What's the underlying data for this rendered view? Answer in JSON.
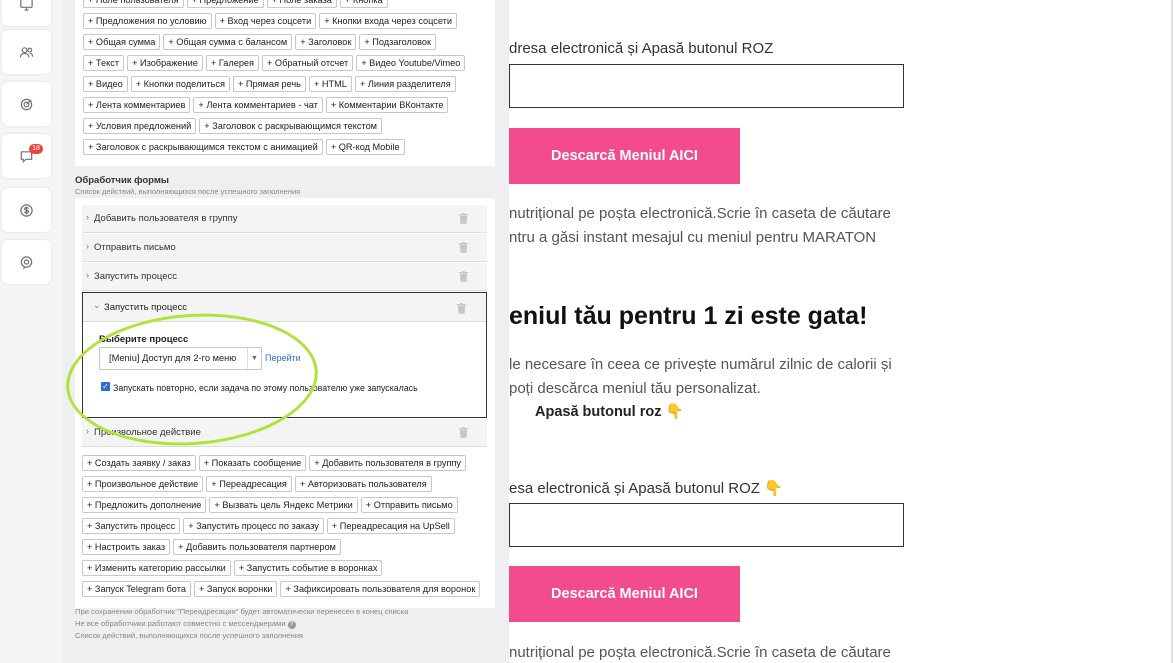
{
  "rail": {
    "badge": "18",
    "icons": [
      "monitor-icon",
      "users-icon",
      "target-icon",
      "chat-icon",
      "dollar-icon",
      "support-icon"
    ]
  },
  "editor": {
    "chips_top": [
      "+ Поле пользователя",
      "+ Предложение",
      "+ Поле заказа",
      "+ Кнопка",
      "+ Предложения по условию",
      "+ Вход через соцсети",
      "+ Кнопки входа через соцсети",
      "+ Общая сумма",
      "+ Общая сумма с балансом",
      "+ Заголовок",
      "+ Подзаголовок",
      "+ Текст",
      "+ Изображение",
      "+ Галерея",
      "+ Обратный отсчет",
      "+ Видео Youtube/Vimeo",
      "+ Видео",
      "+ Кнопки поделиться",
      "+ Прямая речь",
      "+ HTML",
      "+ Линия разделителя",
      "+ Лента комментариев",
      "+ Лента комментариев - чат",
      "+ Комментарии ВКонтакте",
      "+ Условия предложений",
      "+ Заголовок с раскрывающимся текстом",
      "+ Заголовок с раскрывающимся текстом с анимацией",
      "+ QR-код Mobile"
    ],
    "handler_title": "Обработчик формы",
    "handler_sub": "Список действий, выполняющихся после успешного заполнения",
    "actions": [
      "Добавить пользователя в группу",
      "Отправить письмо",
      "Запустить процесс"
    ],
    "expanded": {
      "title": "Запустить процесс",
      "field_label": "Выберите процесс",
      "select_value": "[Meniu] Доступ для 2-го меню",
      "link": "Перейти",
      "checkbox_label": "Запускать повторно, если задача по этому пользователю уже запускалась"
    },
    "last_action": "Произвольное действие",
    "chips_bottom": [
      "+ Создать заявку / заказ",
      "+ Показать сообщение",
      "+ Добавить пользователя в группу",
      "+ Произвольное действие",
      "+ Переадресация",
      "+ Авторизовать пользователя",
      "+ Предложить дополнение",
      "+ Вызвать цель Яндекс Метрики",
      "+ Отправить письмо",
      "+ Запустить процесс",
      "+ Запустить процесс по заказу",
      "+ Переадресация на UpSell",
      "+ Настроить заказ",
      "+ Добавить пользователя партнером",
      "+ Изменить категорию рассылки",
      "+ Запустить событие в воронках",
      "+ Запуск Telegram бота",
      "+ Запуск воронки",
      "+ Зафиксировать пользователя для воронок"
    ],
    "notes": [
      "При сохранении обработчик \"Переадресация\" будет автоматически перенесен в конец списка",
      "Не все обработчики работают совместно с мессенджерами",
      "Список действий, выполняющихся после успешного заполнения"
    ]
  },
  "page": {
    "label1": "dresa electronică și Apasă butonul ROZ",
    "button1": "Descarcă Meniul AICI",
    "text1a": "nutrițional pe poșta electronică.Scrie în caseta de căutare",
    "text1b": "ntru a găsi instant mesajul cu meniul pentru MARATON",
    "heading": "eniul tău pentru 1 zi este gata!",
    "text2a": "le necesare în ceea ce privește numărul zilnic de calorii și",
    "text2b": "poți descărca meniul tău personalizat.",
    "bold": "Apasă butonul roz 👇",
    "label2": "esa electronică și Apasă butonul ROZ 👇",
    "button2": "Descarcă Meniul AICI",
    "text3a": "nutrițional pe poșta electronică.Scrie în caseta de căutare"
  }
}
